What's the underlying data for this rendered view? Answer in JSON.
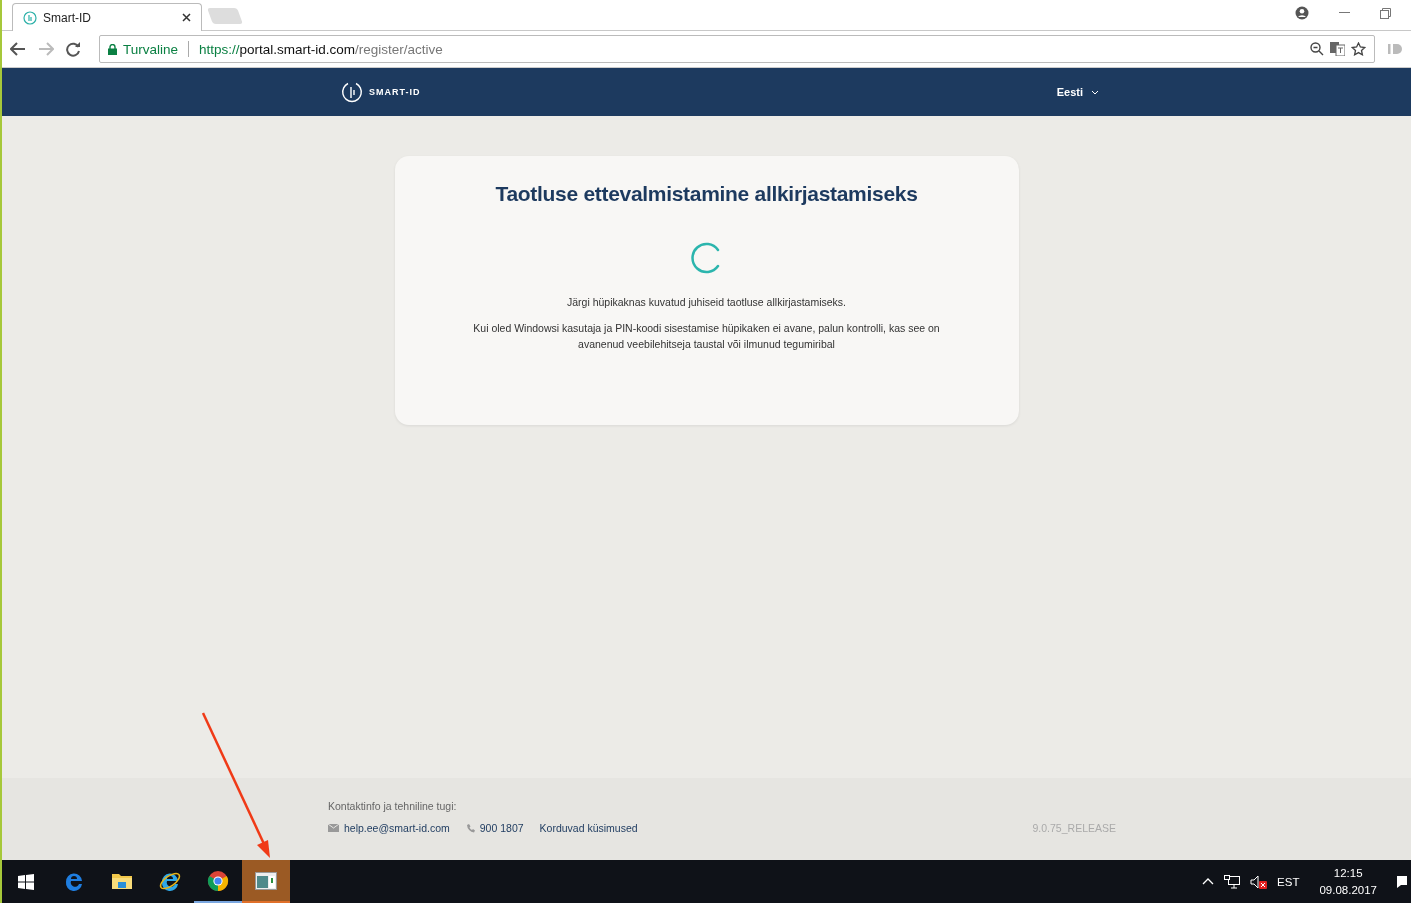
{
  "browser": {
    "tab": {
      "title": "Smart-ID"
    },
    "security_label": "Turvaline",
    "url": {
      "scheme": "https://",
      "host": "portal.smart-id.com",
      "path": "/register/active"
    }
  },
  "header": {
    "logo_text": "SMART-ID",
    "language": "Eesti"
  },
  "card": {
    "title": "Taotluse ettevalmistamine allkirjastamiseks",
    "paragraphs": [
      "Järgi hüpikaknas kuvatud juhiseid taotluse allkirjastamiseks.",
      "Kui oled Windowsi kasutaja ja PIN-koodi sisestamise hüpikaken ei avane, palun kontrolli, kas see on avanenud veebilehitseja taustal või ilmunud tegumiribal"
    ]
  },
  "footer": {
    "heading": "Kontaktinfo ja tehniline tugi:",
    "email": "help.ee@smart-id.com",
    "phone": "900 1807",
    "faq": "Korduvad küsimused",
    "version": "9.0.75_RELEASE"
  },
  "taskbar": {
    "apps": [
      {
        "kind": "edge",
        "running": false,
        "active": false
      },
      {
        "kind": "explorer",
        "running": false,
        "active": false
      },
      {
        "kind": "ie",
        "running": false,
        "active": false
      },
      {
        "kind": "chrome",
        "running": true,
        "active": false
      },
      {
        "kind": "window",
        "running": true,
        "active": true
      }
    ],
    "language": "EST",
    "time": "12:15",
    "date": "09.08.2017"
  }
}
